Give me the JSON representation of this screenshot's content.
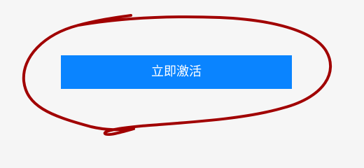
{
  "activation": {
    "button_label": "立即激活"
  },
  "annotation": {
    "color": "#a10000",
    "shape": "hand-drawn-circle"
  },
  "colors": {
    "button_bg": "#0a84ff",
    "button_text": "#ffffff",
    "page_bg": "#f6f6f6"
  }
}
